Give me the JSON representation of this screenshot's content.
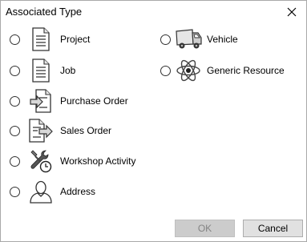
{
  "window": {
    "title": "Associated Type",
    "close_icon": "close-icon"
  },
  "options_left": [
    {
      "label": "Project",
      "icon": "document-icon"
    },
    {
      "label": "Job",
      "icon": "document-icon"
    },
    {
      "label": "Purchase Order",
      "icon": "purchase-order-icon"
    },
    {
      "label": "Sales Order",
      "icon": "sales-order-icon"
    },
    {
      "label": "Workshop Activity",
      "icon": "wrench-clock-icon"
    },
    {
      "label": "Address",
      "icon": "person-icon"
    }
  ],
  "options_right": [
    {
      "label": "Vehicle",
      "icon": "truck-icon"
    },
    {
      "label": "Generic Resource",
      "icon": "atom-icon"
    }
  ],
  "buttons": {
    "ok_label": "OK",
    "cancel_label": "Cancel",
    "ok_enabled": false
  }
}
